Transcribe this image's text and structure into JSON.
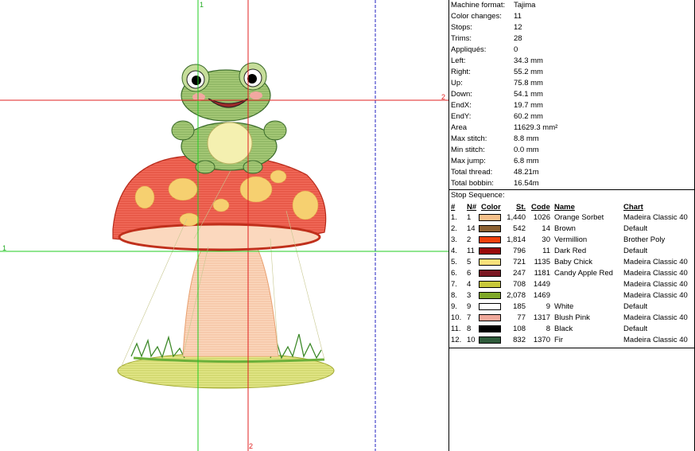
{
  "guides": {
    "top_green": "1",
    "right_red": "2",
    "left_green": "1",
    "bottom_red": "2"
  },
  "stats": [
    {
      "key": "Machine format:",
      "value": "Tajima"
    },
    {
      "key": "Color changes:",
      "value": "11"
    },
    {
      "key": "Stops:",
      "value": "12"
    },
    {
      "key": "Trims:",
      "value": "28"
    },
    {
      "key": "Appliqués:",
      "value": "0"
    },
    {
      "key": "Left:",
      "value": "34.3 mm"
    },
    {
      "key": "Right:",
      "value": "55.2 mm"
    },
    {
      "key": "Up:",
      "value": "75.8 mm"
    },
    {
      "key": "Down:",
      "value": "54.1 mm"
    },
    {
      "key": "EndX:",
      "value": "19.7 mm"
    },
    {
      "key": "EndY:",
      "value": "60.2 mm"
    },
    {
      "key": "Area",
      "value": "11629.3 mm²"
    },
    {
      "key": "Max stitch:",
      "value": "8.8 mm"
    },
    {
      "key": "Min stitch:",
      "value": "0.0 mm"
    },
    {
      "key": "Max jump:",
      "value": "6.8 mm"
    },
    {
      "key": "Total thread:",
      "value": "48.21m"
    },
    {
      "key": "Total bobbin:",
      "value": "16.54m"
    }
  ],
  "sequence": {
    "title": "Stop Sequence:",
    "headers": {
      "num": "#",
      "n": "N#",
      "color": "Color",
      "st": "St.",
      "code": "Code",
      "name": "Name",
      "chart": "Chart"
    },
    "rows": [
      {
        "num": "1.",
        "n": "1",
        "color": "#F7C08A",
        "st": "1,440",
        "code": "1026",
        "name": "Orange Sorbet",
        "chart": "Madeira Classic 40"
      },
      {
        "num": "2.",
        "n": "14",
        "color": "#8C6133",
        "st": "542",
        "code": "14",
        "name": "Brown",
        "chart": "Default"
      },
      {
        "num": "3.",
        "n": "2",
        "color": "#F0400A",
        "st": "1,814",
        "code": "30",
        "name": "Vermillion",
        "chart": "Brother Poly"
      },
      {
        "num": "4.",
        "n": "11",
        "color": "#9A0A0A",
        "st": "796",
        "code": "11",
        "name": "Dark Red",
        "chart": "Default"
      },
      {
        "num": "5.",
        "n": "5",
        "color": "#F8E07A",
        "st": "721",
        "code": "1135",
        "name": "Baby Chick",
        "chart": "Madeira Classic 40"
      },
      {
        "num": "6.",
        "n": "6",
        "color": "#7A1622",
        "st": "247",
        "code": "1181",
        "name": "Candy Apple Red",
        "chart": "Madeira Classic 40"
      },
      {
        "num": "7.",
        "n": "4",
        "color": "#C8C83A",
        "st": "708",
        "code": "1449",
        "name": "",
        "chart": "Madeira Classic 40"
      },
      {
        "num": "8.",
        "n": "3",
        "color": "#7FA828",
        "st": "2,078",
        "code": "1469",
        "name": "",
        "chart": "Madeira Classic 40"
      },
      {
        "num": "9.",
        "n": "9",
        "color": "#FFFFFF",
        "st": "185",
        "code": "9",
        "name": "White",
        "chart": "Default"
      },
      {
        "num": "10.",
        "n": "7",
        "color": "#F0A89A",
        "st": "77",
        "code": "1317",
        "name": "Blush Pink",
        "chart": "Madeira Classic 40"
      },
      {
        "num": "11.",
        "n": "8",
        "color": "#000000",
        "st": "108",
        "code": "8",
        "name": "Black",
        "chart": "Default"
      },
      {
        "num": "12.",
        "n": "10",
        "color": "#2E5A3A",
        "st": "832",
        "code": "1370",
        "name": "Fir",
        "chart": "Madeira Classic 40"
      }
    ]
  }
}
